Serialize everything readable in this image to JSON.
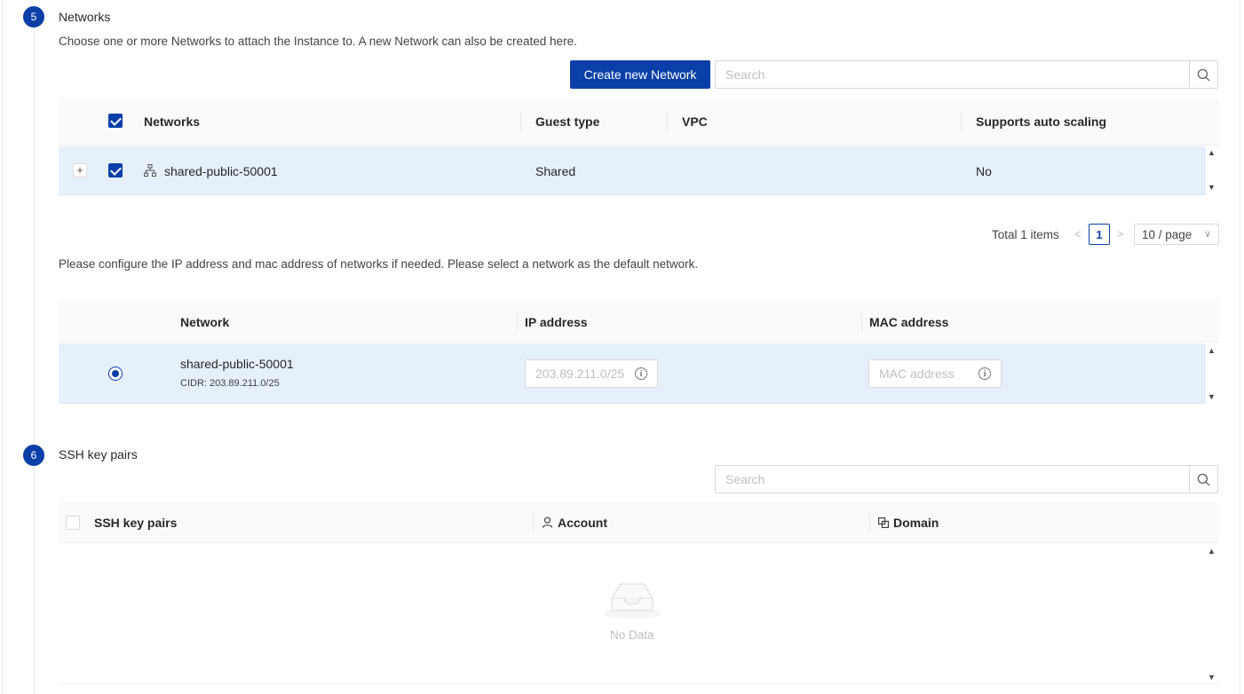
{
  "step5": {
    "number": "5",
    "title": "Networks",
    "description": "Choose one or more Networks to attach the Instance to. A new Network can also be created here.",
    "create_button": "Create new Network",
    "search_placeholder": "Search",
    "table": {
      "columns": [
        "Networks",
        "Guest type",
        "VPC",
        "Supports auto scaling"
      ],
      "rows": [
        {
          "name": "shared-public-50001",
          "guest_type": "Shared",
          "vpc": "",
          "auto_scaling": "No",
          "selected": true
        }
      ]
    },
    "pagination": {
      "total_label": "Total 1 items",
      "current_page": "1",
      "page_size": "10 / page"
    },
    "config_description": "Please configure the IP address and mac address of networks if needed. Please select a network as the default network.",
    "config_table": {
      "columns": [
        "Network",
        "IP address",
        "MAC address"
      ],
      "rows": [
        {
          "name": "shared-public-50001",
          "cidr": "CIDR: 203.89.211.0/25",
          "ip_placeholder": "203.89.211.0/25",
          "mac_placeholder": "MAC address",
          "default": true
        }
      ]
    }
  },
  "step6": {
    "number": "6",
    "title": "SSH key pairs",
    "search_placeholder": "Search",
    "table": {
      "columns": [
        "SSH key pairs",
        "Account",
        "Domain"
      ],
      "empty_text": "No Data"
    }
  },
  "colors": {
    "primary": "#0a3fa8",
    "row_selected": "#e6f0fb",
    "header_bg": "#fafafa"
  }
}
